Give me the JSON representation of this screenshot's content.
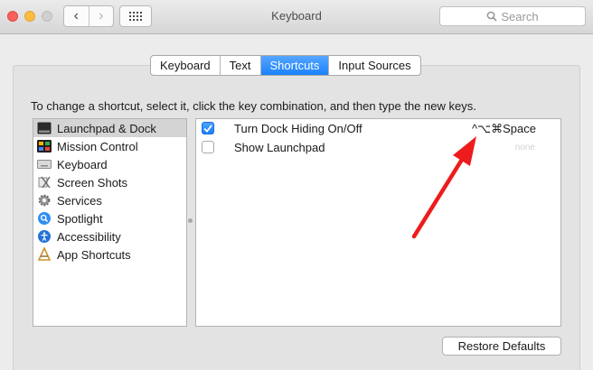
{
  "window": {
    "title": "Keyboard",
    "search_placeholder": "Search",
    "nav_back": "‹",
    "nav_forward": "›"
  },
  "tabs": [
    {
      "label": "Keyboard",
      "active": false
    },
    {
      "label": "Text",
      "active": false
    },
    {
      "label": "Shortcuts",
      "active": true
    },
    {
      "label": "Input Sources",
      "active": false
    }
  ],
  "instructions": "To change a shortcut, select it, click the key combination, and then type the new keys.",
  "categories": [
    {
      "label": "Launchpad & Dock",
      "icon": "launchpad-dock-icon",
      "selected": true
    },
    {
      "label": "Mission Control",
      "icon": "mission-control-icon",
      "selected": false
    },
    {
      "label": "Keyboard",
      "icon": "keyboard-icon",
      "selected": false
    },
    {
      "label": "Screen Shots",
      "icon": "screenshot-icon",
      "selected": false
    },
    {
      "label": "Services",
      "icon": "gear-icon",
      "selected": false
    },
    {
      "label": "Spotlight",
      "icon": "spotlight-icon",
      "selected": false
    },
    {
      "label": "Accessibility",
      "icon": "accessibility-icon",
      "selected": false
    },
    {
      "label": "App Shortcuts",
      "icon": "app-shortcuts-icon",
      "selected": false
    }
  ],
  "shortcuts": [
    {
      "label": "Turn Dock Hiding On/Off",
      "checked": true,
      "key": "^⌥⌘Space"
    },
    {
      "label": "Show Launchpad",
      "checked": false,
      "key": "none"
    }
  ],
  "restore_label": "Restore Defaults",
  "colors": {
    "accent": "#1a82fb",
    "annotation_arrow": "#ee1c1c"
  }
}
